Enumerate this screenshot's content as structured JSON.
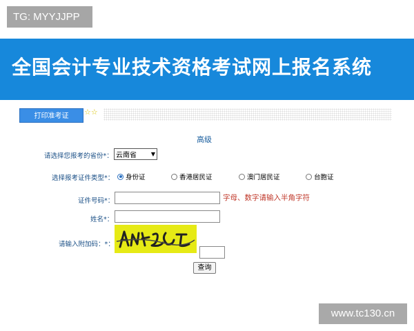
{
  "watermarks": {
    "top": "TG: MYYJJPP",
    "bottom": "www.tc130.cn"
  },
  "banner": {
    "title": "全国会计专业技术资格考试网上报名系统"
  },
  "nav": {
    "tab_label": "打印准考证",
    "stars": "☆☆"
  },
  "form": {
    "level_title": "高级",
    "province": {
      "label": "请选择您报考的省份*：",
      "value": "云南省"
    },
    "id_type": {
      "label": "选择报考证件类型*：",
      "options": [
        {
          "label": "身份证",
          "selected": true
        },
        {
          "label": "香港居民证",
          "selected": false
        },
        {
          "label": "澳门居民证",
          "selected": false
        },
        {
          "label": "台胞证",
          "selected": false
        }
      ]
    },
    "id_number": {
      "label": "证件号码*：",
      "value": "",
      "hint": "字母、数字请输入半角字符"
    },
    "name": {
      "label": "姓名*：",
      "value": ""
    },
    "captcha": {
      "label": "请输入附加码：*：",
      "value": ""
    },
    "submit_label": "查询"
  },
  "colors": {
    "banner_bg": "#1788db",
    "tab_bg": "#3a8ee6",
    "captcha_bg": "#e6ea15",
    "hint": "#c0392b"
  }
}
